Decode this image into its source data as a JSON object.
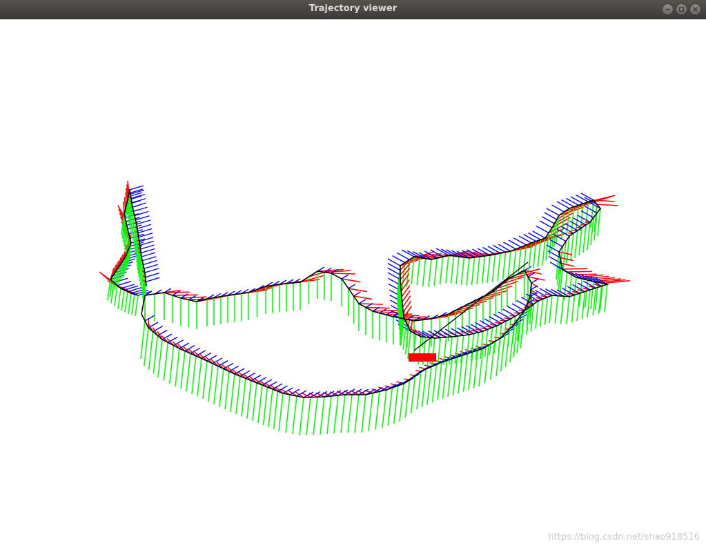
{
  "window": {
    "title": "Trajectory viewer",
    "buttons": {
      "minimize": "minimize-icon",
      "maximize": "maximize-icon",
      "close": "close-icon"
    }
  },
  "viewer": {
    "background": "#ffffff",
    "axis_colors": {
      "x": "#ff0000",
      "y": "#00ff00",
      "z": "#0000ff"
    },
    "path_color": "#000000"
  },
  "watermark": "https://blog.csdn.net/shao918516"
}
